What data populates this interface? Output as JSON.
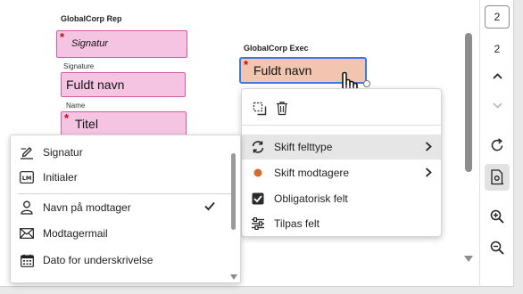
{
  "canvas": {
    "rep_section_title": "GlobalCorp Rep",
    "exec_section_title": "GlobalCorp Exec",
    "rep_fields": [
      {
        "label": "",
        "value": "Signatur",
        "required": true
      },
      {
        "label": "Signature",
        "value": "Fuldt navn",
        "required": false
      },
      {
        "label": "Name",
        "value": "Titel",
        "required": true
      }
    ],
    "exec_field": {
      "value": "Fuldt navn",
      "required": true
    }
  },
  "field_types_menu": {
    "items": [
      {
        "label": "Signatur",
        "icon": "pen-sign-icon",
        "checked": false
      },
      {
        "label": "Initialer",
        "icon": "initials-icon",
        "checked": false
      },
      {
        "label": "Navn på modtager",
        "icon": "person-icon",
        "checked": true
      },
      {
        "label": "Modtagermail",
        "icon": "mail-icon",
        "checked": false
      },
      {
        "label": "Dato for underskrivelse",
        "icon": "calendar-icon",
        "checked": false
      }
    ]
  },
  "context_menu": {
    "items": [
      {
        "label": "Skift felttype",
        "icon": "swap-icon",
        "submenu": true,
        "highlighted": true
      },
      {
        "label": "Skift modtagere",
        "icon": "recipient-dot-icon",
        "submenu": true,
        "highlighted": false
      },
      {
        "label": "Obligatorisk felt",
        "icon": "checkbox-checked-icon",
        "submenu": false,
        "highlighted": false
      },
      {
        "label": "Tilpas felt",
        "icon": "sliders-icon",
        "submenu": false,
        "highlighted": false
      }
    ]
  },
  "right_rail": {
    "current_page": "2",
    "total_pages": "2"
  },
  "colors": {
    "field_fill": "#f5c4e3",
    "field_border": "#d45aa6",
    "exec_fill": "#f2c5b0",
    "selection_blue": "#3a7be0",
    "recipient_dot": "#d46a2c",
    "highlight": "#e6e6e6",
    "required_star": "#d7000f"
  }
}
